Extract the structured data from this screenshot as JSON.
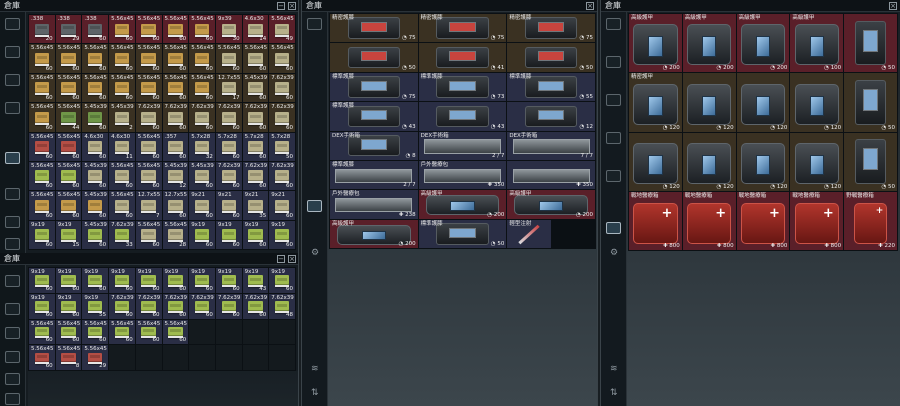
{
  "colors": {
    "rare": "#5a1f29",
    "standard": "#2a2e45",
    "beige": "#3a3122",
    "empty": "#141a1e"
  },
  "left_top": {
    "title": "倉庫",
    "cols": 10,
    "rows": [
      [
        {
          "n": ".338",
          "c": "20",
          "k": "ammo-dark",
          "b": "rare"
        },
        {
          "n": ".338",
          "c": "29",
          "k": "ammo-dark",
          "b": "rare"
        },
        {
          "n": ".338",
          "c": "60",
          "k": "ammo-dark",
          "b": "rare"
        },
        {
          "n": "5.56x45",
          "c": "60",
          "k": "ammo-gold",
          "b": "rare"
        },
        {
          "n": "5.56x45",
          "c": "60",
          "k": "ammo-gold",
          "b": "rare"
        },
        {
          "n": "5.56x45",
          "c": "60",
          "k": "ammo-gold",
          "b": "rare"
        },
        {
          "n": "5.56x45",
          "c": "60",
          "k": "ammo-gold",
          "b": "rare"
        },
        {
          "n": "9x39",
          "c": "30",
          "k": "ammo-khaki",
          "b": "rare"
        },
        {
          "n": "4.6x30",
          "c": "14",
          "k": "ammo-khaki",
          "b": "rare"
        },
        {
          "n": "5.56x45",
          "c": "49",
          "k": "ammo-khaki",
          "b": "rare"
        }
      ],
      [
        {
          "n": "5.56x45",
          "c": "60",
          "k": "ammo-gold",
          "b": "beige"
        },
        {
          "n": "5.56x45",
          "c": "60",
          "k": "ammo-gold",
          "b": "beige"
        },
        {
          "n": "5.56x45",
          "c": "60",
          "k": "ammo-gold",
          "b": "beige"
        },
        {
          "n": "5.56x45",
          "c": "60",
          "k": "ammo-gold",
          "b": "beige"
        },
        {
          "n": "5.56x45",
          "c": "60",
          "k": "ammo-gold",
          "b": "beige"
        },
        {
          "n": "5.56x45",
          "c": "60",
          "k": "ammo-gold",
          "b": "beige"
        },
        {
          "n": "5.56x45",
          "c": "60",
          "k": "ammo-gold",
          "b": "beige"
        },
        {
          "n": "5.56x45",
          "c": "60",
          "k": "ammo-khaki",
          "b": "beige"
        },
        {
          "n": "5.56x45",
          "c": "60",
          "k": "ammo-khaki",
          "b": "beige"
        },
        {
          "n": "5.56x45",
          "c": "60",
          "k": "ammo-khaki",
          "b": "beige"
        }
      ],
      [
        {
          "n": "5.56x45",
          "c": "60",
          "k": "ammo-gold",
          "b": "beige"
        },
        {
          "n": "5.56x45",
          "c": "60",
          "k": "ammo-gold",
          "b": "beige"
        },
        {
          "n": "5.56x45",
          "c": "60",
          "k": "ammo-gold",
          "b": "beige"
        },
        {
          "n": "5.56x45",
          "c": "60",
          "k": "ammo-gold",
          "b": "beige"
        },
        {
          "n": "5.56x45",
          "c": "60",
          "k": "ammo-gold",
          "b": "beige"
        },
        {
          "n": "5.56x45",
          "c": "60",
          "k": "ammo-gold",
          "b": "beige"
        },
        {
          "n": "5.56x45",
          "c": "60",
          "k": "ammo-gold",
          "b": "beige"
        },
        {
          "n": "12.7x55",
          "c": "17",
          "k": "ammo-khaki",
          "b": "beige"
        },
        {
          "n": "5.45x39",
          "c": "60",
          "k": "ammo-khaki",
          "b": "beige"
        },
        {
          "n": "7.62x39",
          "c": "60",
          "k": "ammo-khaki",
          "b": "beige"
        }
      ],
      [
        {
          "n": "5.56x45",
          "c": "60",
          "k": "ammo-gold",
          "b": "beige"
        },
        {
          "n": "5.56x45",
          "c": "44",
          "k": "ammo-green",
          "b": "beige"
        },
        {
          "n": "5.45x39",
          "c": "60",
          "k": "ammo-green",
          "b": "beige"
        },
        {
          "n": "5.45x39",
          "c": "2",
          "k": "ammo-khaki",
          "b": "beige"
        },
        {
          "n": "7.62x39",
          "c": "60",
          "k": "ammo-khaki",
          "b": "beige"
        },
        {
          "n": "7.62x39",
          "c": "60",
          "k": "ammo-khaki",
          "b": "beige"
        },
        {
          "n": "7.62x39",
          "c": "60",
          "k": "ammo-khaki",
          "b": "beige"
        },
        {
          "n": "7.62x39",
          "c": "60",
          "k": "ammo-khaki",
          "b": "beige"
        },
        {
          "n": "7.62x39",
          "c": "60",
          "k": "ammo-khaki",
          "b": "beige"
        },
        {
          "n": "7.62x39",
          "c": "60",
          "k": "ammo-khaki",
          "b": "beige"
        }
      ],
      [
        {
          "n": "5.56x45",
          "c": "60",
          "k": "ammo-red",
          "b": "standard"
        },
        {
          "n": "5.56x45",
          "c": "60",
          "k": "ammo-red",
          "b": "standard"
        },
        {
          "n": "4.6x30",
          "c": "60",
          "k": "ammo-khaki",
          "b": "standard"
        },
        {
          "n": "4.6x30",
          "c": "11",
          "k": "ammo-khaki",
          "b": "standard"
        },
        {
          "n": "5.56x45",
          "c": "60",
          "k": "ammo-khaki",
          "b": "standard"
        },
        {
          "n": ".357",
          "c": "60",
          "k": "ammo-khaki",
          "b": "standard"
        },
        {
          "n": "5.7x28",
          "c": "32",
          "k": "ammo-khaki",
          "b": "standard"
        },
        {
          "n": "5.7x28",
          "c": "60",
          "k": "ammo-khaki",
          "b": "standard"
        },
        {
          "n": "5.7x28",
          "c": "60",
          "k": "ammo-khaki",
          "b": "standard"
        },
        {
          "n": "5.7x28",
          "c": "50",
          "k": "ammo-khaki",
          "b": "standard"
        }
      ],
      [
        {
          "n": "5.56x45",
          "c": "60",
          "k": "ammo-lime",
          "b": "standard"
        },
        {
          "n": "5.56x45",
          "c": "60",
          "k": "ammo-lime",
          "b": "standard"
        },
        {
          "n": "5.45x39",
          "c": "60",
          "k": "ammo-khaki",
          "b": "standard"
        },
        {
          "n": "5.56x45",
          "c": "60",
          "k": "ammo-khaki",
          "b": "standard"
        },
        {
          "n": "5.56x45",
          "c": "60",
          "k": "ammo-khaki",
          "b": "standard"
        },
        {
          "n": "5.45x39",
          "c": "12",
          "k": "ammo-khaki",
          "b": "standard"
        },
        {
          "n": "5.45x39",
          "c": "60",
          "k": "ammo-khaki",
          "b": "standard"
        },
        {
          "n": "7.62x39",
          "c": "60",
          "k": "ammo-khaki",
          "b": "standard"
        },
        {
          "n": "7.62x39",
          "c": "60",
          "k": "ammo-khaki",
          "b": "standard"
        },
        {
          "n": "7.62x39",
          "c": "60",
          "k": "ammo-khaki",
          "b": "standard"
        }
      ],
      [
        {
          "n": "5.56x45",
          "c": "60",
          "k": "ammo-gold",
          "b": "standard"
        },
        {
          "n": "5.56x45",
          "c": "60",
          "k": "ammo-gold",
          "b": "standard"
        },
        {
          "n": "5.45x39",
          "c": "60",
          "k": "ammo-gold",
          "b": "standard"
        },
        {
          "n": "5.56x45",
          "c": "60",
          "k": "ammo-khaki",
          "b": "standard"
        },
        {
          "n": "12.7x55",
          "c": "7",
          "k": "ammo-khaki",
          "b": "standard"
        },
        {
          "n": "12.7x55",
          "c": "60",
          "k": "ammo-khaki",
          "b": "standard"
        },
        {
          "n": "9x21",
          "c": "60",
          "k": "ammo-khaki",
          "b": "standard"
        },
        {
          "n": "9x21",
          "c": "60",
          "k": "ammo-khaki",
          "b": "standard"
        },
        {
          "n": "9x21",
          "c": "35",
          "k": "ammo-khaki",
          "b": "standard"
        },
        {
          "n": "9x21",
          "c": "60",
          "k": "ammo-khaki",
          "b": "standard"
        }
      ],
      [
        {
          "n": "9x19",
          "c": "60",
          "k": "ammo-lime",
          "b": "standard"
        },
        {
          "n": "9x19",
          "c": "15",
          "k": "ammo-lime",
          "b": "standard"
        },
        {
          "n": "5.45x39",
          "c": "60",
          "k": "ammo-lime",
          "b": "standard"
        },
        {
          "n": "7.62x39",
          "c": "33",
          "k": "ammo-lime",
          "b": "standard"
        },
        {
          "n": "5.56x45",
          "c": "60",
          "k": "ammo-khaki",
          "b": "standard"
        },
        {
          "n": "5.56x45",
          "c": "28",
          "k": "ammo-khaki",
          "b": "standard"
        },
        {
          "n": "9x19",
          "c": "60",
          "k": "ammo-lime",
          "b": "standard"
        },
        {
          "n": "9x19",
          "c": "60",
          "k": "ammo-lime",
          "b": "standard"
        },
        {
          "n": "9x19",
          "c": "60",
          "k": "ammo-lime",
          "b": "standard"
        },
        {
          "n": "9x19",
          "c": "60",
          "k": "ammo-lime",
          "b": "standard"
        }
      ]
    ]
  },
  "left_bottom": {
    "title": "倉庫",
    "cols": 10,
    "rows": [
      [
        {
          "n": "9x19",
          "c": "60",
          "k": "ammo-lime",
          "b": "standard"
        },
        {
          "n": "9x19",
          "c": "60",
          "k": "ammo-lime",
          "b": "standard"
        },
        {
          "n": "9x19",
          "c": "60",
          "k": "ammo-lime",
          "b": "standard"
        },
        {
          "n": "9x19",
          "c": "60",
          "k": "ammo-lime",
          "b": "standard"
        },
        {
          "n": "9x19",
          "c": "60",
          "k": "ammo-lime",
          "b": "standard"
        },
        {
          "n": "9x19",
          "c": "60",
          "k": "ammo-lime",
          "b": "standard"
        },
        {
          "n": "9x19",
          "c": "60",
          "k": "ammo-lime",
          "b": "standard"
        },
        {
          "n": "9x19",
          "c": "60",
          "k": "ammo-lime",
          "b": "standard"
        },
        {
          "n": "9x19",
          "c": "43",
          "k": "ammo-lime",
          "b": "standard"
        },
        {
          "n": "9x19",
          "c": "60",
          "k": "ammo-lime",
          "b": "standard"
        }
      ],
      [
        {
          "n": "9x19",
          "c": "60",
          "k": "ammo-lime",
          "b": "standard"
        },
        {
          "n": "9x19",
          "c": "60",
          "k": "ammo-lime",
          "b": "standard"
        },
        {
          "n": "9x19",
          "c": "55",
          "k": "ammo-lime",
          "b": "standard"
        },
        {
          "n": "7.62x39",
          "c": "60",
          "k": "ammo-lime",
          "b": "standard"
        },
        {
          "n": "7.62x39",
          "c": "60",
          "k": "ammo-lime",
          "b": "standard"
        },
        {
          "n": "7.62x39",
          "c": "60",
          "k": "ammo-lime",
          "b": "standard"
        },
        {
          "n": "7.62x39",
          "c": "60",
          "k": "ammo-lime",
          "b": "standard"
        },
        {
          "n": "7.62x39",
          "c": "60",
          "k": "ammo-lime",
          "b": "standard"
        },
        {
          "n": "7.62x39",
          "c": "60",
          "k": "ammo-lime",
          "b": "standard"
        },
        {
          "n": "7.62x39",
          "c": "48",
          "k": "ammo-lime",
          "b": "standard"
        }
      ],
      [
        {
          "n": "5.56x45",
          "c": "60",
          "k": "ammo-lime",
          "b": "standard"
        },
        {
          "n": "5.56x45",
          "c": "60",
          "k": "ammo-lime",
          "b": "standard"
        },
        {
          "n": "5.56x45",
          "c": "60",
          "k": "ammo-lime",
          "b": "standard"
        },
        {
          "n": "5.56x45",
          "c": "60",
          "k": "ammo-lime",
          "b": "standard"
        },
        {
          "n": "5.56x45",
          "c": "60",
          "k": "ammo-lime",
          "b": "standard"
        },
        {
          "n": "5.56x45",
          "c": "60",
          "k": "ammo-lime",
          "b": "standard"
        },
        {
          "n": "",
          "c": "",
          "k": "",
          "b": "empty"
        },
        {
          "n": "",
          "c": "",
          "k": "",
          "b": "empty"
        },
        {
          "n": "",
          "c": "",
          "k": "",
          "b": "empty"
        },
        {
          "n": "",
          "c": "",
          "k": "",
          "b": "empty"
        }
      ],
      [
        {
          "n": "5.56x45",
          "c": "60",
          "k": "ammo-red",
          "b": "standard"
        },
        {
          "n": "5.56x45",
          "c": "8",
          "k": "ammo-red",
          "b": "standard"
        },
        {
          "n": "5.56x45",
          "c": "29",
          "k": "ammo-red",
          "b": "standard"
        },
        {
          "n": "",
          "c": "",
          "k": "",
          "b": "empty"
        },
        {
          "n": "",
          "c": "",
          "k": "",
          "b": "empty"
        },
        {
          "n": "",
          "c": "",
          "k": "",
          "b": "empty"
        },
        {
          "n": "",
          "c": "",
          "k": "",
          "b": "empty"
        },
        {
          "n": "",
          "c": "",
          "k": "",
          "b": "empty"
        },
        {
          "n": "",
          "c": "",
          "k": "",
          "b": "empty"
        },
        {
          "n": "",
          "c": "",
          "k": "",
          "b": "empty"
        }
      ]
    ]
  },
  "middle": {
    "title": "倉庫",
    "cols": 6,
    "items": [
      {
        "n": "精密護膝",
        "c": "◔ 75",
        "k": "plate-red",
        "b": "beige",
        "s": 2
      },
      {
        "n": "精密護膝",
        "c": "◔ 75",
        "k": "plate-red",
        "b": "beige",
        "s": 2
      },
      {
        "n": "精密護膝",
        "c": "◔ 75",
        "k": "plate-red",
        "b": "beige",
        "s": 2
      },
      {
        "n": "",
        "c": "◔ 50",
        "k": "plate-red",
        "b": "beige",
        "s": 2
      },
      {
        "n": "",
        "c": "◔ 41",
        "k": "plate-red",
        "b": "beige",
        "s": 2
      },
      {
        "n": "",
        "c": "◔ 50",
        "k": "plate-red",
        "b": "beige",
        "s": 2
      },
      {
        "n": "標準護膝",
        "c": "◔ 75",
        "k": "plate-ins",
        "b": "standard",
        "s": 2
      },
      {
        "n": "標準護膝",
        "c": "◔ 73",
        "k": "plate-ins",
        "b": "standard",
        "s": 2
      },
      {
        "n": "標準護膝",
        "c": "◔ 55",
        "k": "plate-ins",
        "b": "standard",
        "s": 2
      },
      {
        "n": "標準護膝",
        "c": "◔ 43",
        "k": "plate-ins",
        "b": "standard",
        "s": 2
      },
      {
        "n": "",
        "c": "◔ 43",
        "k": "plate-ins",
        "b": "standard",
        "s": 2
      },
      {
        "n": "",
        "c": "◔ 12",
        "k": "plate-ins",
        "b": "standard",
        "s": 2
      },
      {
        "n": "DEX手術箱",
        "c": "◔ 8",
        "k": "plate-dark",
        "b": "standard",
        "s": 2
      },
      {
        "n": "DEX手術箱",
        "c": "2 / 7",
        "k": "kit",
        "b": "standard",
        "s": 2
      },
      {
        "n": "DEX手術箱",
        "c": "7 / 7",
        "k": "kit",
        "b": "standard",
        "s": 2
      },
      {
        "n": "標準護膝",
        "c": "2 / 7",
        "k": "kit",
        "b": "standard",
        "s": 2
      },
      {
        "n": "戶外醫療包",
        "c": "✚ 350",
        "k": "kit",
        "b": "standard",
        "s": 2
      },
      {
        "n": "",
        "c": "✚ 350",
        "k": "kit",
        "b": "standard",
        "s": 2
      },
      {
        "n": "戶外醫療包",
        "c": "✚ 238",
        "k": "kit",
        "b": "standard",
        "s": 2
      },
      {
        "n": "高級護甲",
        "c": "◔ 200",
        "k": "bag",
        "b": "rare",
        "s": 2
      },
      {
        "n": "高級護甲",
        "c": "◔ 200",
        "k": "bag",
        "b": "rare",
        "s": 2
      },
      {
        "n": "高級護甲",
        "c": "◔ 200",
        "k": "bag",
        "b": "rare",
        "s": 2
      },
      {
        "n": "標準護膝",
        "c": "◔ 50",
        "k": "plate-dark",
        "b": "standard",
        "s": 2
      },
      {
        "n": "輕型注射",
        "c": "",
        "k": "syringe",
        "b": "standard",
        "s": 1
      }
    ]
  },
  "right": {
    "title": "倉庫",
    "cols": 5,
    "items": [
      {
        "n": "高級護甲",
        "c": "◔ 200",
        "k": "bag",
        "b": "rare"
      },
      {
        "n": "高級護甲",
        "c": "◔ 200",
        "k": "bag",
        "b": "rare"
      },
      {
        "n": "高級護甲",
        "c": "◔ 200",
        "k": "bag",
        "b": "rare"
      },
      {
        "n": "高級護甲",
        "c": "◔ 100",
        "k": "bag",
        "b": "rare"
      },
      {
        "n": "",
        "c": "◔ 50",
        "k": "plate-small",
        "b": "rare"
      },
      {
        "n": "精密護甲",
        "c": "◔ 120",
        "k": "bag",
        "b": "beige"
      },
      {
        "n": "",
        "c": "◔ 120",
        "k": "bag",
        "b": "beige"
      },
      {
        "n": "",
        "c": "◔ 120",
        "k": "bag",
        "b": "beige"
      },
      {
        "n": "",
        "c": "◔ 120",
        "k": "bag",
        "b": "beige"
      },
      {
        "n": "",
        "c": "◔ 50",
        "k": "plate-small",
        "b": "beige"
      },
      {
        "n": "",
        "c": "◔ 120",
        "k": "bag",
        "b": "beige"
      },
      {
        "n": "",
        "c": "◔ 120",
        "k": "bag",
        "b": "beige"
      },
      {
        "n": "",
        "c": "◔ 120",
        "k": "bag",
        "b": "beige"
      },
      {
        "n": "",
        "c": "◔ 120",
        "k": "bag",
        "b": "beige"
      },
      {
        "n": "",
        "c": "◔ 50",
        "k": "plate-small",
        "b": "beige"
      },
      {
        "n": "戰地醫療箱",
        "c": "✚ 800",
        "k": "med",
        "b": "rare"
      },
      {
        "n": "戰地醫療箱",
        "c": "✚ 800",
        "k": "med",
        "b": "rare"
      },
      {
        "n": "戰地醫療箱",
        "c": "✚ 800",
        "k": "med",
        "b": "rare"
      },
      {
        "n": "戰地醫療箱",
        "c": "✚ 800",
        "k": "med",
        "b": "rare"
      },
      {
        "n": "野戰醫療箱",
        "c": "✚ 220",
        "k": "med-small",
        "b": "rare"
      }
    ]
  },
  "sidebar": {
    "icons": [
      "helmet-icon",
      "armor-icon",
      "backpack-icon",
      "bag-icon",
      "weapon-icon",
      "pistol-icon",
      "ammo-icon",
      "medical-icon",
      "misc-icon",
      "settings-icon"
    ]
  }
}
